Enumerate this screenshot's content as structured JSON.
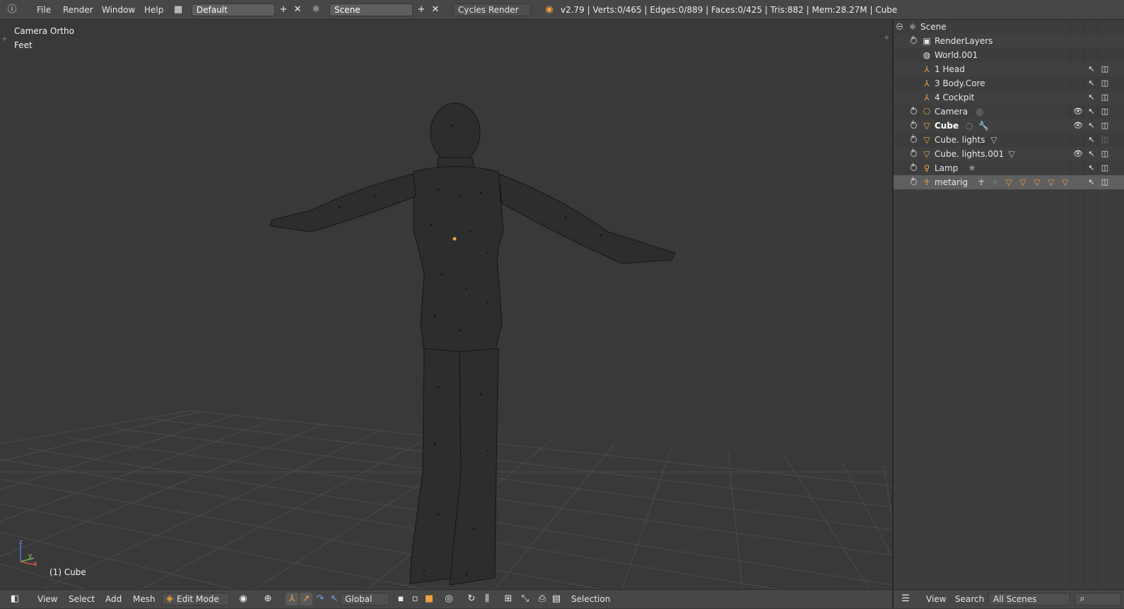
{
  "topbar": {
    "menus": [
      "File",
      "Render",
      "Window",
      "Help"
    ],
    "screen_layout": "Default",
    "scene": "Scene",
    "render_engine": "Cycles Render",
    "stats": "v2.79 | Verts:0/465 | Edges:0/889 | Faces:0/425 | Tris:882 | Mem:28.27M | Cube"
  },
  "viewport": {
    "view_name": "Camera Ortho",
    "units": "Feet",
    "object_label": "(1) Cube",
    "axis_x": "x",
    "axis_y": "y",
    "axis_z": "z"
  },
  "bottombar": {
    "menus": [
      "View",
      "Select",
      "Add",
      "Mesh"
    ],
    "mode": "Edit Mode",
    "orientation": "Global",
    "selection_label": "Selection"
  },
  "outliner": {
    "items": [
      {
        "label": "Scene",
        "icon": "scene-icon"
      },
      {
        "label": "RenderLayers",
        "icon": "render-layers-icon"
      },
      {
        "label": "World.001",
        "icon": "world-icon"
      },
      {
        "label": "1 Head",
        "icon": "empty-icon"
      },
      {
        "label": "3 Body.Core",
        "icon": "empty-icon"
      },
      {
        "label": "4 Cockpit",
        "icon": "empty-icon"
      },
      {
        "label": "Camera",
        "icon": "camera-icon"
      },
      {
        "label": "Cube",
        "icon": "mesh-icon"
      },
      {
        "label": "Cube. lights",
        "icon": "mesh-icon"
      },
      {
        "label": "Cube. lights.001",
        "icon": "mesh-icon"
      },
      {
        "label": "Lamp",
        "icon": "lamp-icon"
      },
      {
        "label": "metarig",
        "icon": "armature-icon"
      }
    ],
    "footer": {
      "view": "View",
      "search": "Search",
      "display_mode": "All Scenes"
    }
  },
  "colors": {
    "accent": "#f0a040",
    "background": "#393939",
    "header": "#474747"
  }
}
